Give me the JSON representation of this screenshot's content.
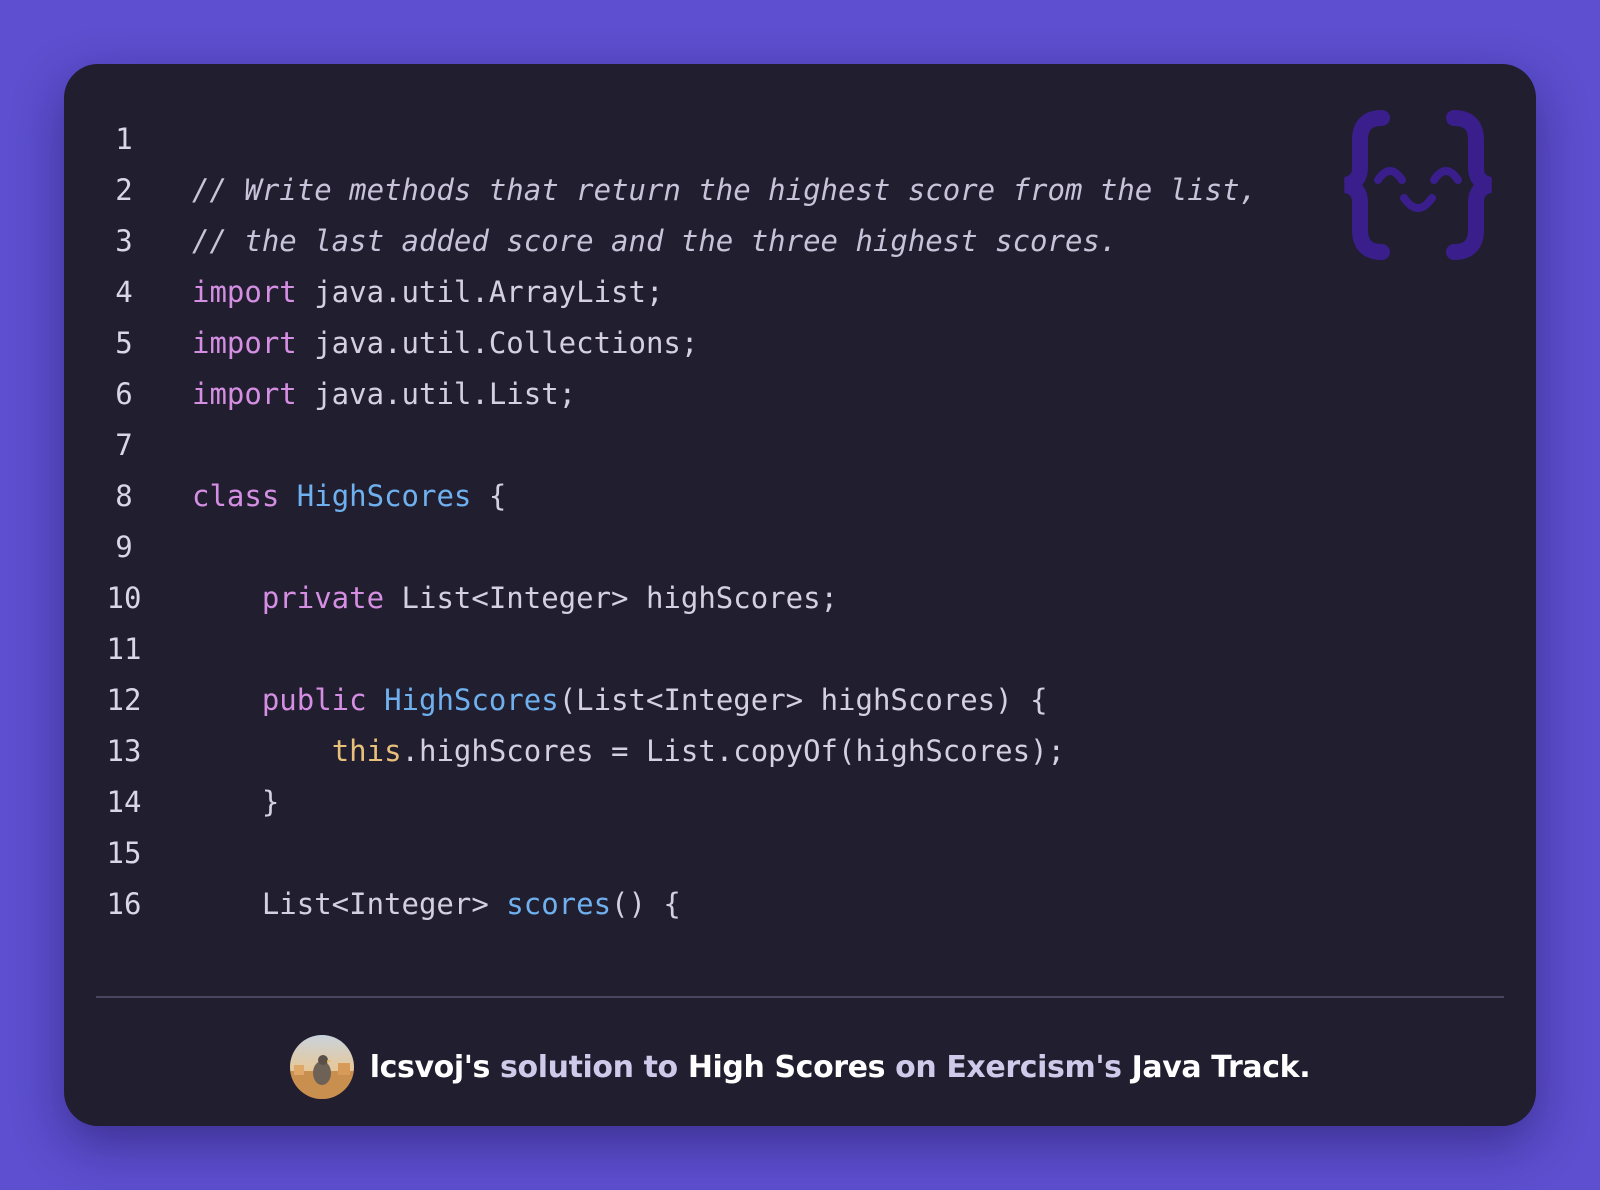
{
  "code": {
    "language": "Java",
    "lines": [
      {
        "num": "1",
        "tokens": []
      },
      {
        "num": "2",
        "tokens": [
          {
            "t": "// Write methods that return the highest score from the list,",
            "k": "cm"
          }
        ]
      },
      {
        "num": "3",
        "tokens": [
          {
            "t": "// the last added score and the three highest scores.",
            "k": "cm"
          }
        ]
      },
      {
        "num": "4",
        "tokens": [
          {
            "t": "import",
            "k": "kw"
          },
          {
            "t": " java.util.ArrayList;",
            "k": "pl"
          }
        ]
      },
      {
        "num": "5",
        "tokens": [
          {
            "t": "import",
            "k": "kw"
          },
          {
            "t": " java.util.Collections;",
            "k": "pl"
          }
        ]
      },
      {
        "num": "6",
        "tokens": [
          {
            "t": "import",
            "k": "kw"
          },
          {
            "t": " java.util.List;",
            "k": "pl"
          }
        ]
      },
      {
        "num": "7",
        "tokens": []
      },
      {
        "num": "8",
        "tokens": [
          {
            "t": "class",
            "k": "kw"
          },
          {
            "t": " ",
            "k": "pl"
          },
          {
            "t": "HighScores",
            "k": "ty"
          },
          {
            "t": " {",
            "k": "pl"
          }
        ]
      },
      {
        "num": "9",
        "tokens": []
      },
      {
        "num": "10",
        "tokens": [
          {
            "t": "    ",
            "k": "pl"
          },
          {
            "t": "private",
            "k": "kw"
          },
          {
            "t": " List<Integer> highScores;",
            "k": "pl"
          }
        ]
      },
      {
        "num": "11",
        "tokens": []
      },
      {
        "num": "12",
        "tokens": [
          {
            "t": "    ",
            "k": "pl"
          },
          {
            "t": "public",
            "k": "kw"
          },
          {
            "t": " ",
            "k": "pl"
          },
          {
            "t": "HighScores",
            "k": "ty"
          },
          {
            "t": "(List<Integer> highScores) {",
            "k": "pl"
          }
        ]
      },
      {
        "num": "13",
        "tokens": [
          {
            "t": "        ",
            "k": "pl"
          },
          {
            "t": "this",
            "k": "th"
          },
          {
            "t": ".highScores = List.copyOf(highScores);",
            "k": "pl"
          }
        ]
      },
      {
        "num": "14",
        "tokens": [
          {
            "t": "    }",
            "k": "pl"
          }
        ]
      },
      {
        "num": "15",
        "tokens": []
      },
      {
        "num": "16",
        "tokens": [
          {
            "t": "    List<Integer> ",
            "k": "pl"
          },
          {
            "t": "scores",
            "k": "ty"
          },
          {
            "t": "() {",
            "k": "pl"
          }
        ]
      }
    ]
  },
  "logo": {
    "icon": "exercism-braces-face-icon",
    "color": "#3a1e8c"
  },
  "footer": {
    "author": "lcsvoj",
    "author_suffix": "'s",
    "solution_to": " solution to ",
    "exercise": "High Scores",
    "on": " on ",
    "platform": "Exercism",
    "platform_suffix": "'s",
    "track": " Java Track."
  },
  "colors": {
    "background": "#5d4fcf",
    "card": "#211e30",
    "keyword": "#d58fe2",
    "type": "#6fb0ee",
    "this": "#e8c07a",
    "comment": "#c8c3d8",
    "plain": "#d4d0e0"
  }
}
